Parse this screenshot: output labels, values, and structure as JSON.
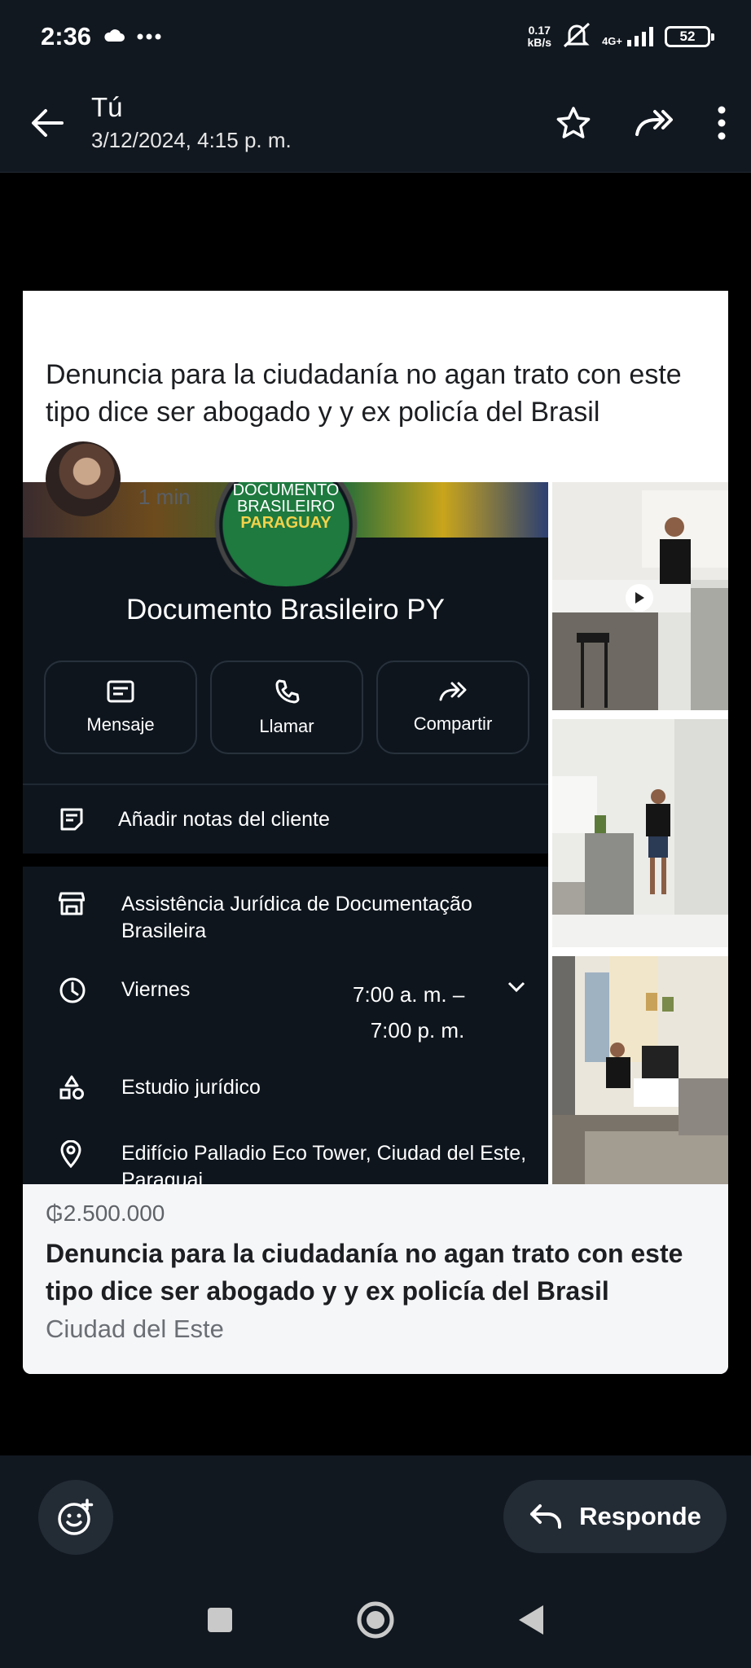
{
  "status_bar": {
    "time": "2:36",
    "speed_value": "0.17",
    "speed_unit": "kB/s",
    "network": "4G+",
    "battery": "52"
  },
  "header": {
    "sender": "Tú",
    "datetime": "3/12/2024, 4:15 p. m."
  },
  "post": {
    "time": "1 min",
    "text": "Denuncia para la ciudadanía no agan trato con este tipo dice ser abogado y y ex policía del Brasil"
  },
  "business": {
    "logo_line1": "DOCUMENTO",
    "logo_line2": "BRASILEIRO",
    "logo_line3": "PARAGUAY",
    "name": "Documento Brasileiro PY",
    "actions": [
      {
        "label": "Mensaje",
        "icon": "message-icon"
      },
      {
        "label": "Llamar",
        "icon": "phone-icon"
      },
      {
        "label": "Compartir",
        "icon": "share-icon"
      }
    ],
    "notes": "Añadir notas del cliente",
    "company": "Assistência Jurídica de Documentação Brasileira",
    "day": "Viernes",
    "hours_open": "7:00 a. m. –",
    "hours_close": "7:00 p. m.",
    "category": "Estudio jurídico",
    "address": "Edifício Palladio Eco Tower, Ciudad del Este, Paraguai"
  },
  "listing": {
    "price": "₲2.500.000",
    "title": "Denuncia para la ciudadanía no agan trato con este tipo dice ser abogado y y ex policía del Brasil",
    "location": "Ciudad del Este"
  },
  "reply": {
    "label": "Responde"
  },
  "colors": {
    "app_bg": "#121820",
    "biz_bg": "#0e151d",
    "link": "#6fb3ea"
  }
}
